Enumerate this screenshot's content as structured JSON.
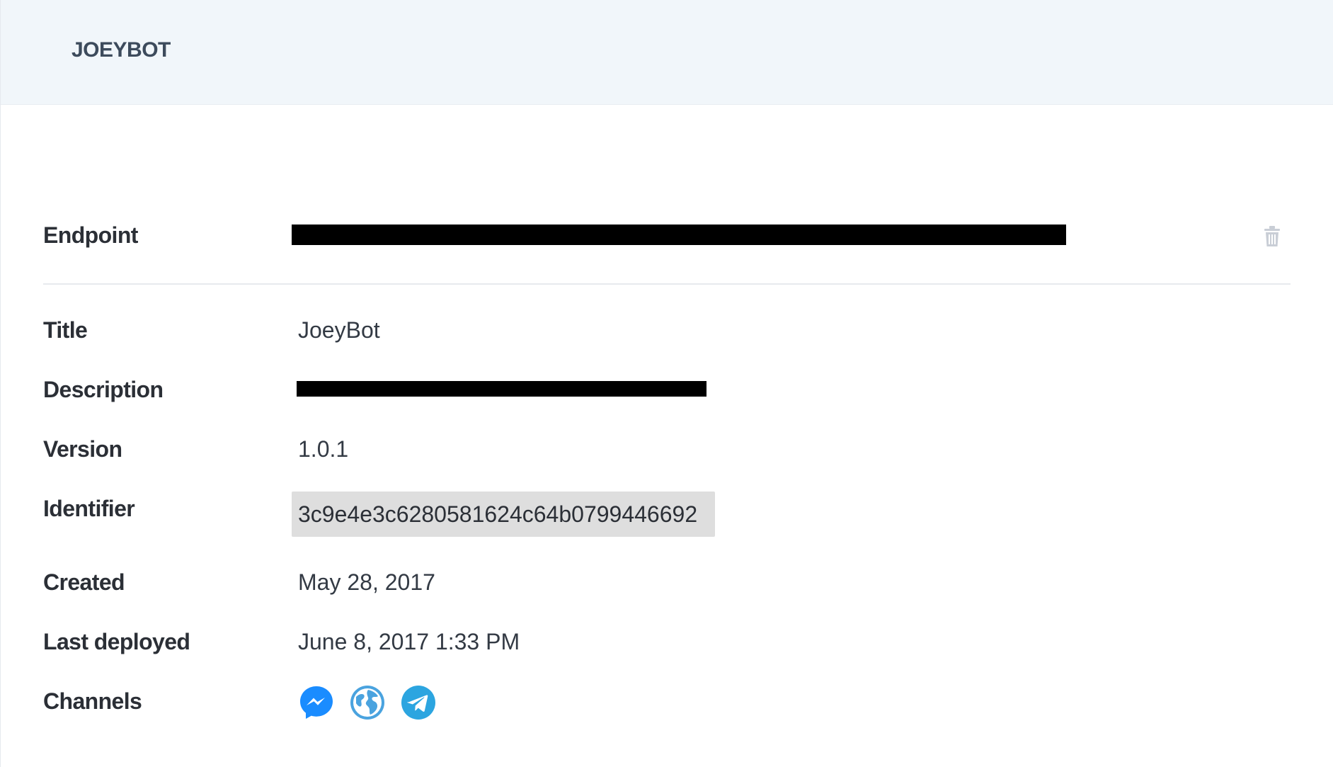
{
  "header": {
    "title": "JOEYBOT"
  },
  "details": {
    "endpoint_label": "Endpoint",
    "title_label": "Title",
    "title_value": "JoeyBot",
    "description_label": "Description",
    "version_label": "Version",
    "version_value": "1.0.1",
    "identifier_label": "Identifier",
    "identifier_value": "3c9e4e3c6280581624c64b0799446692",
    "created_label": "Created",
    "created_value": "May 28, 2017",
    "last_deployed_label": "Last deployed",
    "last_deployed_value": "June 8, 2017 1:33 PM",
    "channels_label": "Channels"
  },
  "channels": [
    {
      "icon": "messenger-icon",
      "color": "#1a8cff"
    },
    {
      "icon": "globe-icon",
      "color": "#4aa3df"
    },
    {
      "icon": "telegram-icon",
      "color": "#2ca5e0"
    }
  ],
  "actions": {
    "delete_icon": "trash-icon"
  }
}
